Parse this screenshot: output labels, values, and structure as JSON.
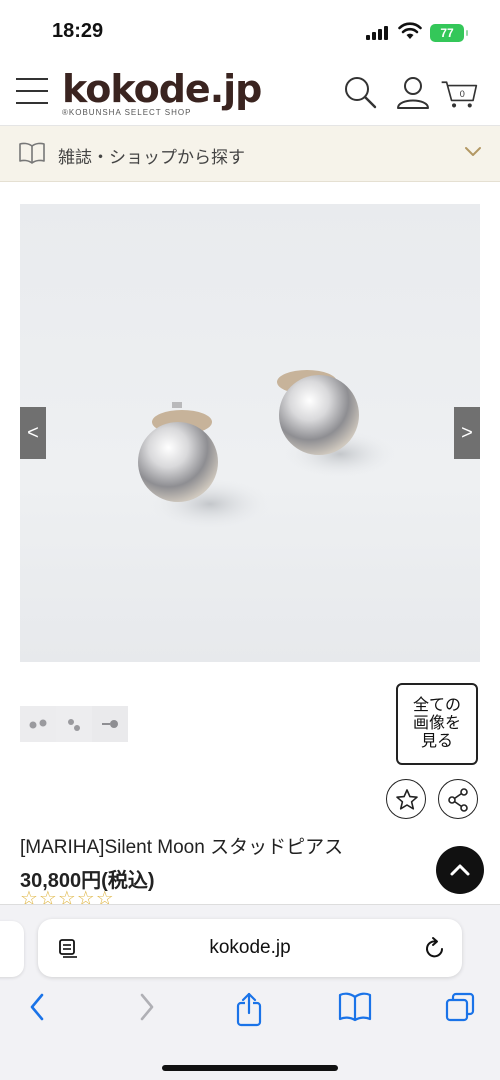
{
  "status_bar": {
    "time": "18:29",
    "battery": "77"
  },
  "header": {
    "logo_text": "kokode.jp",
    "logo_tagline": "®KOBUNSHA SELECT SHOP",
    "cart_count": "0"
  },
  "category_bar": {
    "label": "雑誌・ショップから探す"
  },
  "gallery": {
    "prev_label": "<",
    "next_label": ">",
    "all_images_label": "全ての画像を見る",
    "all_images_lines": [
      "全ての",
      "画像を",
      "見る"
    ]
  },
  "product": {
    "name": "[MARIHA]Silent Moon スタッドピアス",
    "price": "30,800円(税込)",
    "rating_stars": "☆☆☆☆☆"
  },
  "browser": {
    "url": "kokode.jp"
  },
  "colors": {
    "accent_beige": "#f6f3ea",
    "logo_brown": "#3a2420",
    "star_gold": "#e0b84a",
    "battery_green": "#34c759",
    "safari_blue": "#1a73e8"
  },
  "icons": [
    "hamburger-icon",
    "search-icon",
    "user-icon",
    "cart-icon",
    "book-icon",
    "chevron-down-icon",
    "star-icon",
    "share-icon",
    "chevron-up-icon",
    "reader-icon",
    "reload-icon",
    "back-icon",
    "forward-icon",
    "share-sheet-icon",
    "bookmarks-icon",
    "tabs-icon"
  ]
}
